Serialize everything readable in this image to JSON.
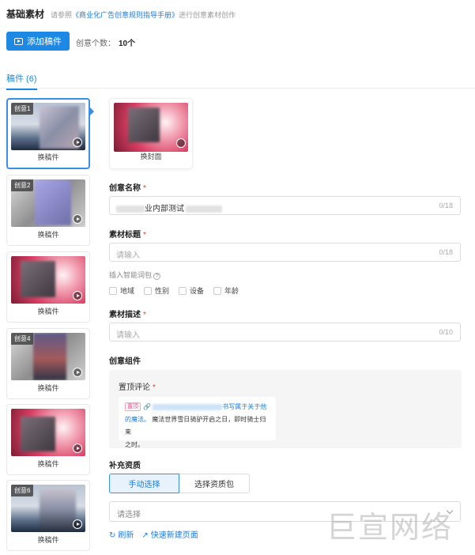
{
  "header": {
    "title": "基础素材",
    "hint_prefix": "请参照",
    "hint_link": "《商业化广告创意规则指导手册》",
    "hint_suffix": "进行创意素材创作"
  },
  "toolbar": {
    "add_label": "添加稿件",
    "count_label": "创意个数：",
    "count_value": "10个"
  },
  "tabs": [
    {
      "label": "稿件 (6)"
    }
  ],
  "cards": [
    {
      "tag": "创意1",
      "label": "换稿件"
    },
    {
      "tag": "创意2",
      "label": "换稿件"
    },
    {
      "tag": "",
      "label": "换稿件"
    },
    {
      "tag": "创意4",
      "label": "换稿件"
    },
    {
      "tag": "",
      "label": "换稿件"
    },
    {
      "tag": "创意6",
      "label": "换稿件"
    }
  ],
  "cover": {
    "label": "换封面"
  },
  "form": {
    "name": {
      "label": "创意名称",
      "required": "*",
      "value": "业内部测试",
      "count": "0/18"
    },
    "title": {
      "label": "素材标题",
      "required": "*",
      "placeholder": "请输入",
      "count": "0/18"
    },
    "smart_words": {
      "label": "插入智能词包",
      "options": [
        "地域",
        "性别",
        "设备",
        "年龄"
      ]
    },
    "desc": {
      "label": "素材描述",
      "required": "*",
      "placeholder": "请输入",
      "count": "0/10"
    }
  },
  "component": {
    "section_label": "创意组件",
    "panel_title": "置顶评论",
    "required": "*",
    "comment": {
      "badge": "置顶",
      "link_tail": "书写属于关于他",
      "line2_link": "的魔法。",
      "line2_rest": "魔法世界雪日骑驴开启之日，即时骑士归来",
      "line3": "之时。"
    }
  },
  "qualification": {
    "section_label": "补充资质",
    "buttons": [
      "手动选择",
      "选择资质包"
    ],
    "select_placeholder": "请选择",
    "refresh": "刷新",
    "new_page": "快速新建页面"
  },
  "watermark": "巨宣网络",
  "colors": {
    "primary": "#1e88e5",
    "required": "#e53935",
    "panel_bg": "#f5f5f6"
  }
}
